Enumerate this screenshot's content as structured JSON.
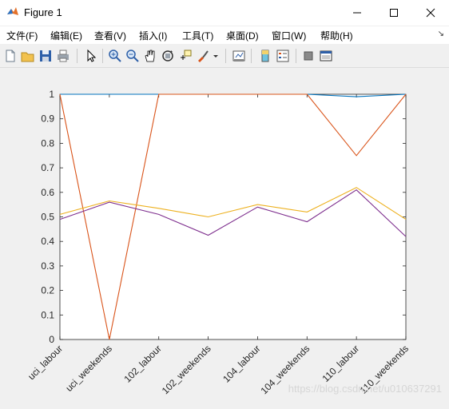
{
  "window": {
    "title": "Figure 1"
  },
  "menu": {
    "items": [
      "文件(F)",
      "编辑(E)",
      "查看(V)",
      "插入(I)",
      "工具(T)",
      "桌面(D)",
      "窗口(W)",
      "帮助(H)"
    ]
  },
  "toolbar": {
    "icons": [
      "new-figure-icon",
      "open-icon",
      "save-icon",
      "print-icon",
      "select-arrow-icon",
      "zoom-in-icon",
      "zoom-out-icon",
      "pan-icon",
      "rotate-3d-icon",
      "data-cursor-icon",
      "brush-icon",
      "link-plot-icon",
      "colorbar-icon",
      "legend-icon",
      "hide-plot-tools-icon",
      "show-plot-tools-icon"
    ]
  },
  "watermark": "https://blog.csdn.net/u010637291",
  "chart_data": {
    "type": "line",
    "categories": [
      "uci_labour",
      "uci_weekends",
      "102_labour",
      "102_weekends",
      "104_labour",
      "104_weekends",
      "110_labour",
      "110_weekends"
    ],
    "ylim": [
      0,
      1
    ],
    "yticks": [
      "0",
      "0.1",
      "0.2",
      "0.3",
      "0.4",
      "0.5",
      "0.6",
      "0.7",
      "0.8",
      "0.9",
      "1"
    ],
    "grid": false,
    "legend": false,
    "title": "",
    "xlabel": "",
    "ylabel": "",
    "series": [
      {
        "color": "#0072bd",
        "values": [
          1.0,
          1.0,
          1.0,
          1.0,
          1.0,
          1.0,
          0.99,
          1.0
        ]
      },
      {
        "color": "#d95319",
        "values": [
          1.0,
          0.0,
          1.0,
          1.0,
          1.0,
          1.0,
          0.75,
          1.0
        ]
      },
      {
        "color": "#edb120",
        "values": [
          0.51,
          0.565,
          0.535,
          0.5,
          0.55,
          0.52,
          0.62,
          0.49
        ]
      },
      {
        "color": "#7e2f8e",
        "values": [
          0.49,
          0.56,
          0.51,
          0.425,
          0.54,
          0.48,
          0.61,
          0.42
        ]
      }
    ]
  }
}
